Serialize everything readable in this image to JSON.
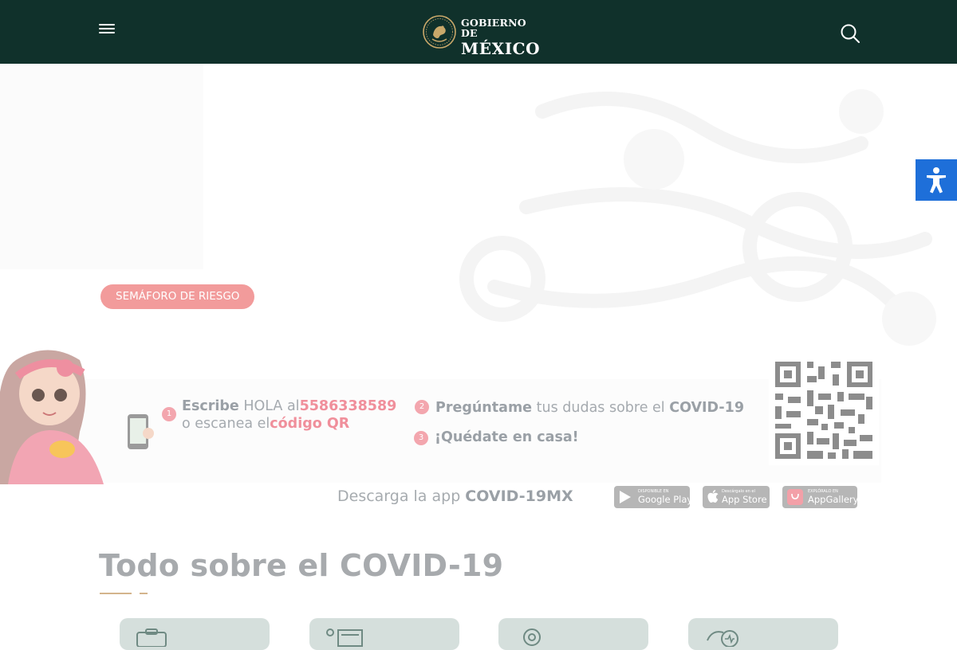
{
  "header": {
    "brand_line1": "GOBIERNO DE",
    "brand_line2": "MÉXICO",
    "icons": {
      "menu": "hamburger-menu-icon",
      "search": "search-icon",
      "seal": "coat-of-arms-icon"
    }
  },
  "hero": {
    "button_label": "SEMÁFORO DE RIESGO",
    "accessibility_icon": "accessibility-icon"
  },
  "chatbot": {
    "step1": {
      "num": "1",
      "bold": "Escribe",
      "text": " HOLA al",
      "phone": "5586338589",
      "line2_text": "o escanea el",
      "line2_link": "código QR"
    },
    "step2": {
      "num": "2",
      "bold": "Pregúntame",
      "text": " tus dudas sobre el ",
      "bold2": "COVID-19"
    },
    "step3": {
      "num": "3",
      "bold": "¡Quédate en casa!"
    }
  },
  "app_download": {
    "prefix": "Descarga la app ",
    "app_name": "COVID-19MX",
    "stores": [
      {
        "small": "DISPONIBLE EN",
        "large": "Google Play",
        "icon": "google-play-icon"
      },
      {
        "small": "Descárgalo en el",
        "large": "App Store",
        "icon": "apple-icon"
      },
      {
        "small": "EXPLÓRALO EN",
        "large": "AppGallery",
        "icon": "huawei-icon"
      }
    ]
  },
  "section": {
    "title": "Todo sobre el COVID-19",
    "cards": [
      {
        "icon": "clipboard-icon"
      },
      {
        "icon": "news-icon"
      },
      {
        "icon": "target-icon"
      },
      {
        "icon": "health-icon"
      }
    ]
  },
  "colors": {
    "header_bg": "#10312b",
    "accent_pink": "#f29b9b",
    "accessibility_blue": "#1e6fd9",
    "card_bg": "#d5dfdc",
    "divider_gold": "#d4b48c"
  }
}
